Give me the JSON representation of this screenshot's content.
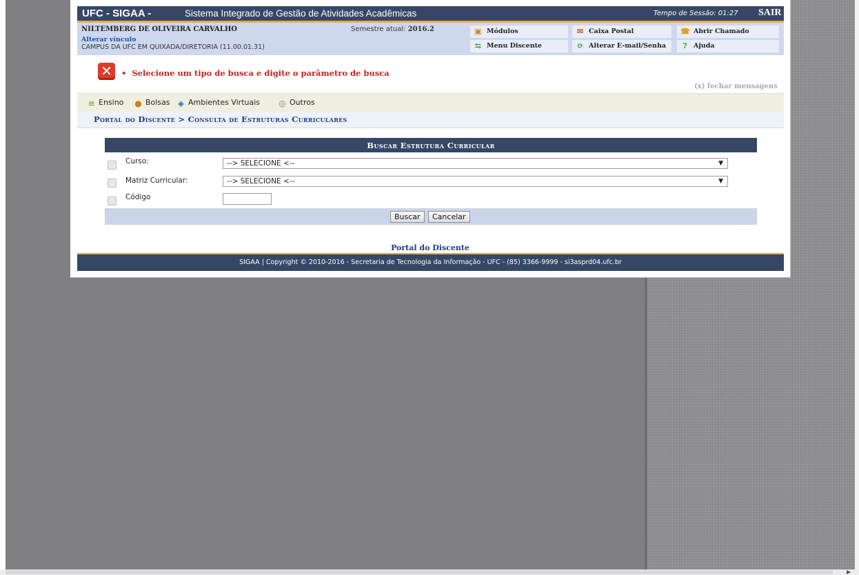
{
  "banner": {
    "brand": "UFC - SIGAA -",
    "system_name": "Sistema Integrado de Gestão de Atividades Acadêmicas",
    "session_label": "Tempo de Sessão: 01:27",
    "logout": "SAIR"
  },
  "user": {
    "name": "NILTEMBERG DE OLIVEIRA CARVALHO",
    "change_link": "Alterar vínculo",
    "campus": "CAMPUS DA UFC EM QUIXADA/DIRETORIA (11.00.01.31)",
    "semester_label": "Semestre atual:",
    "semester_value": "2016.2"
  },
  "quick_links": {
    "modulos": "Módulos",
    "caixa_postal": "Caixa Postal",
    "abrir_chamado": "Abrir Chamado",
    "menu_discente": "Menu Discente",
    "alterar_email": "Alterar E-mail/Senha",
    "ajuda": "Ajuda"
  },
  "message": {
    "error_text": "Selecione um tipo de busca e digite o parâmetro de busca",
    "close_label": "(x) fechar mensagens"
  },
  "menu": {
    "ensino": "Ensino",
    "bolsas": "Bolsas",
    "ambientes": "Ambientes Virtuais",
    "outros": "Outros"
  },
  "breadcrumb": "Portal do Discente > Consulta de Estruturas Curriculares",
  "form": {
    "title": "Buscar Estrutura Curricular",
    "curso_label": "Curso:",
    "curso_value": "--> SELECIONE <--",
    "matriz_label": "Matriz Curricular:",
    "matriz_value": "--> SELECIONE <--",
    "codigo_label": "Código",
    "search_button": "Buscar",
    "cancel_button": "Cancelar"
  },
  "footer": {
    "portal_link": "Portal do Discente",
    "copyright": "SIGAA | Copyright © 2010-2016 - Secretaria de Tecnologia da Informação - UFC - (85) 3366-9999 - si3asprd04.ufc.br"
  },
  "colors": {
    "header_navy": "#364766",
    "accent_orange": "#f2a74a",
    "error_red": "#d0201a",
    "link_blue": "#1f3b78"
  }
}
